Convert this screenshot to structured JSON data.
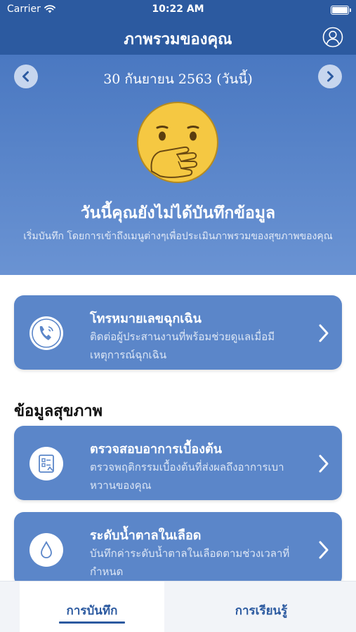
{
  "status_bar": {
    "carrier": "Carrier",
    "time": "10:22 AM"
  },
  "nav": {
    "title": "ภาพรวมของคุณ",
    "profile_icon": "user-circle-icon"
  },
  "date_nav": {
    "date": "30 กันยายน 2563 (วันนี้)"
  },
  "summary": {
    "headline": "วันนี้คุณยังไม่ได้บันทึกข้อมูล",
    "subtitle": "เริ่มบันทึก โดยการเข้าถึงเมนูต่างๆเพื่อประเมินภาพรวมของสุขภาพของคุณ"
  },
  "emergency_card": {
    "title": "โทรหมายเลขฉุกเฉิน",
    "description": "ติดต่อผู้ประสานงานที่พร้อมช่วยดูแลเมื่อมีเหตุการณ์ฉุกเฉิน",
    "icon": "phone-icon"
  },
  "health_section": {
    "title": "ข้อมูลสุขภาพ",
    "cards": [
      {
        "title": "ตรวจสอบอาการเบื้องต้น",
        "description": "ตรวจพฤติกรรมเบื้องต้นที่ส่งผลถึงอาการเบาหวานของคุณ",
        "icon": "checklist-icon"
      },
      {
        "title": "ระดับน้ำตาลในเลือด",
        "description": "บันทึกค่าระดับน้ำตาลในเลือดตามช่วงเวลาที่กำหนด",
        "icon": "blood-drop-icon"
      }
    ]
  },
  "tabs": [
    {
      "label": "การบันทึก",
      "active": true
    },
    {
      "label": "การเรียนรู้",
      "active": false
    }
  ],
  "colors": {
    "primary": "#2c5aa0",
    "hero_top": "#4a78c1",
    "hero_bottom": "#6a93d3",
    "card": "#5b86c9",
    "emoji_face": "#f5c842"
  }
}
